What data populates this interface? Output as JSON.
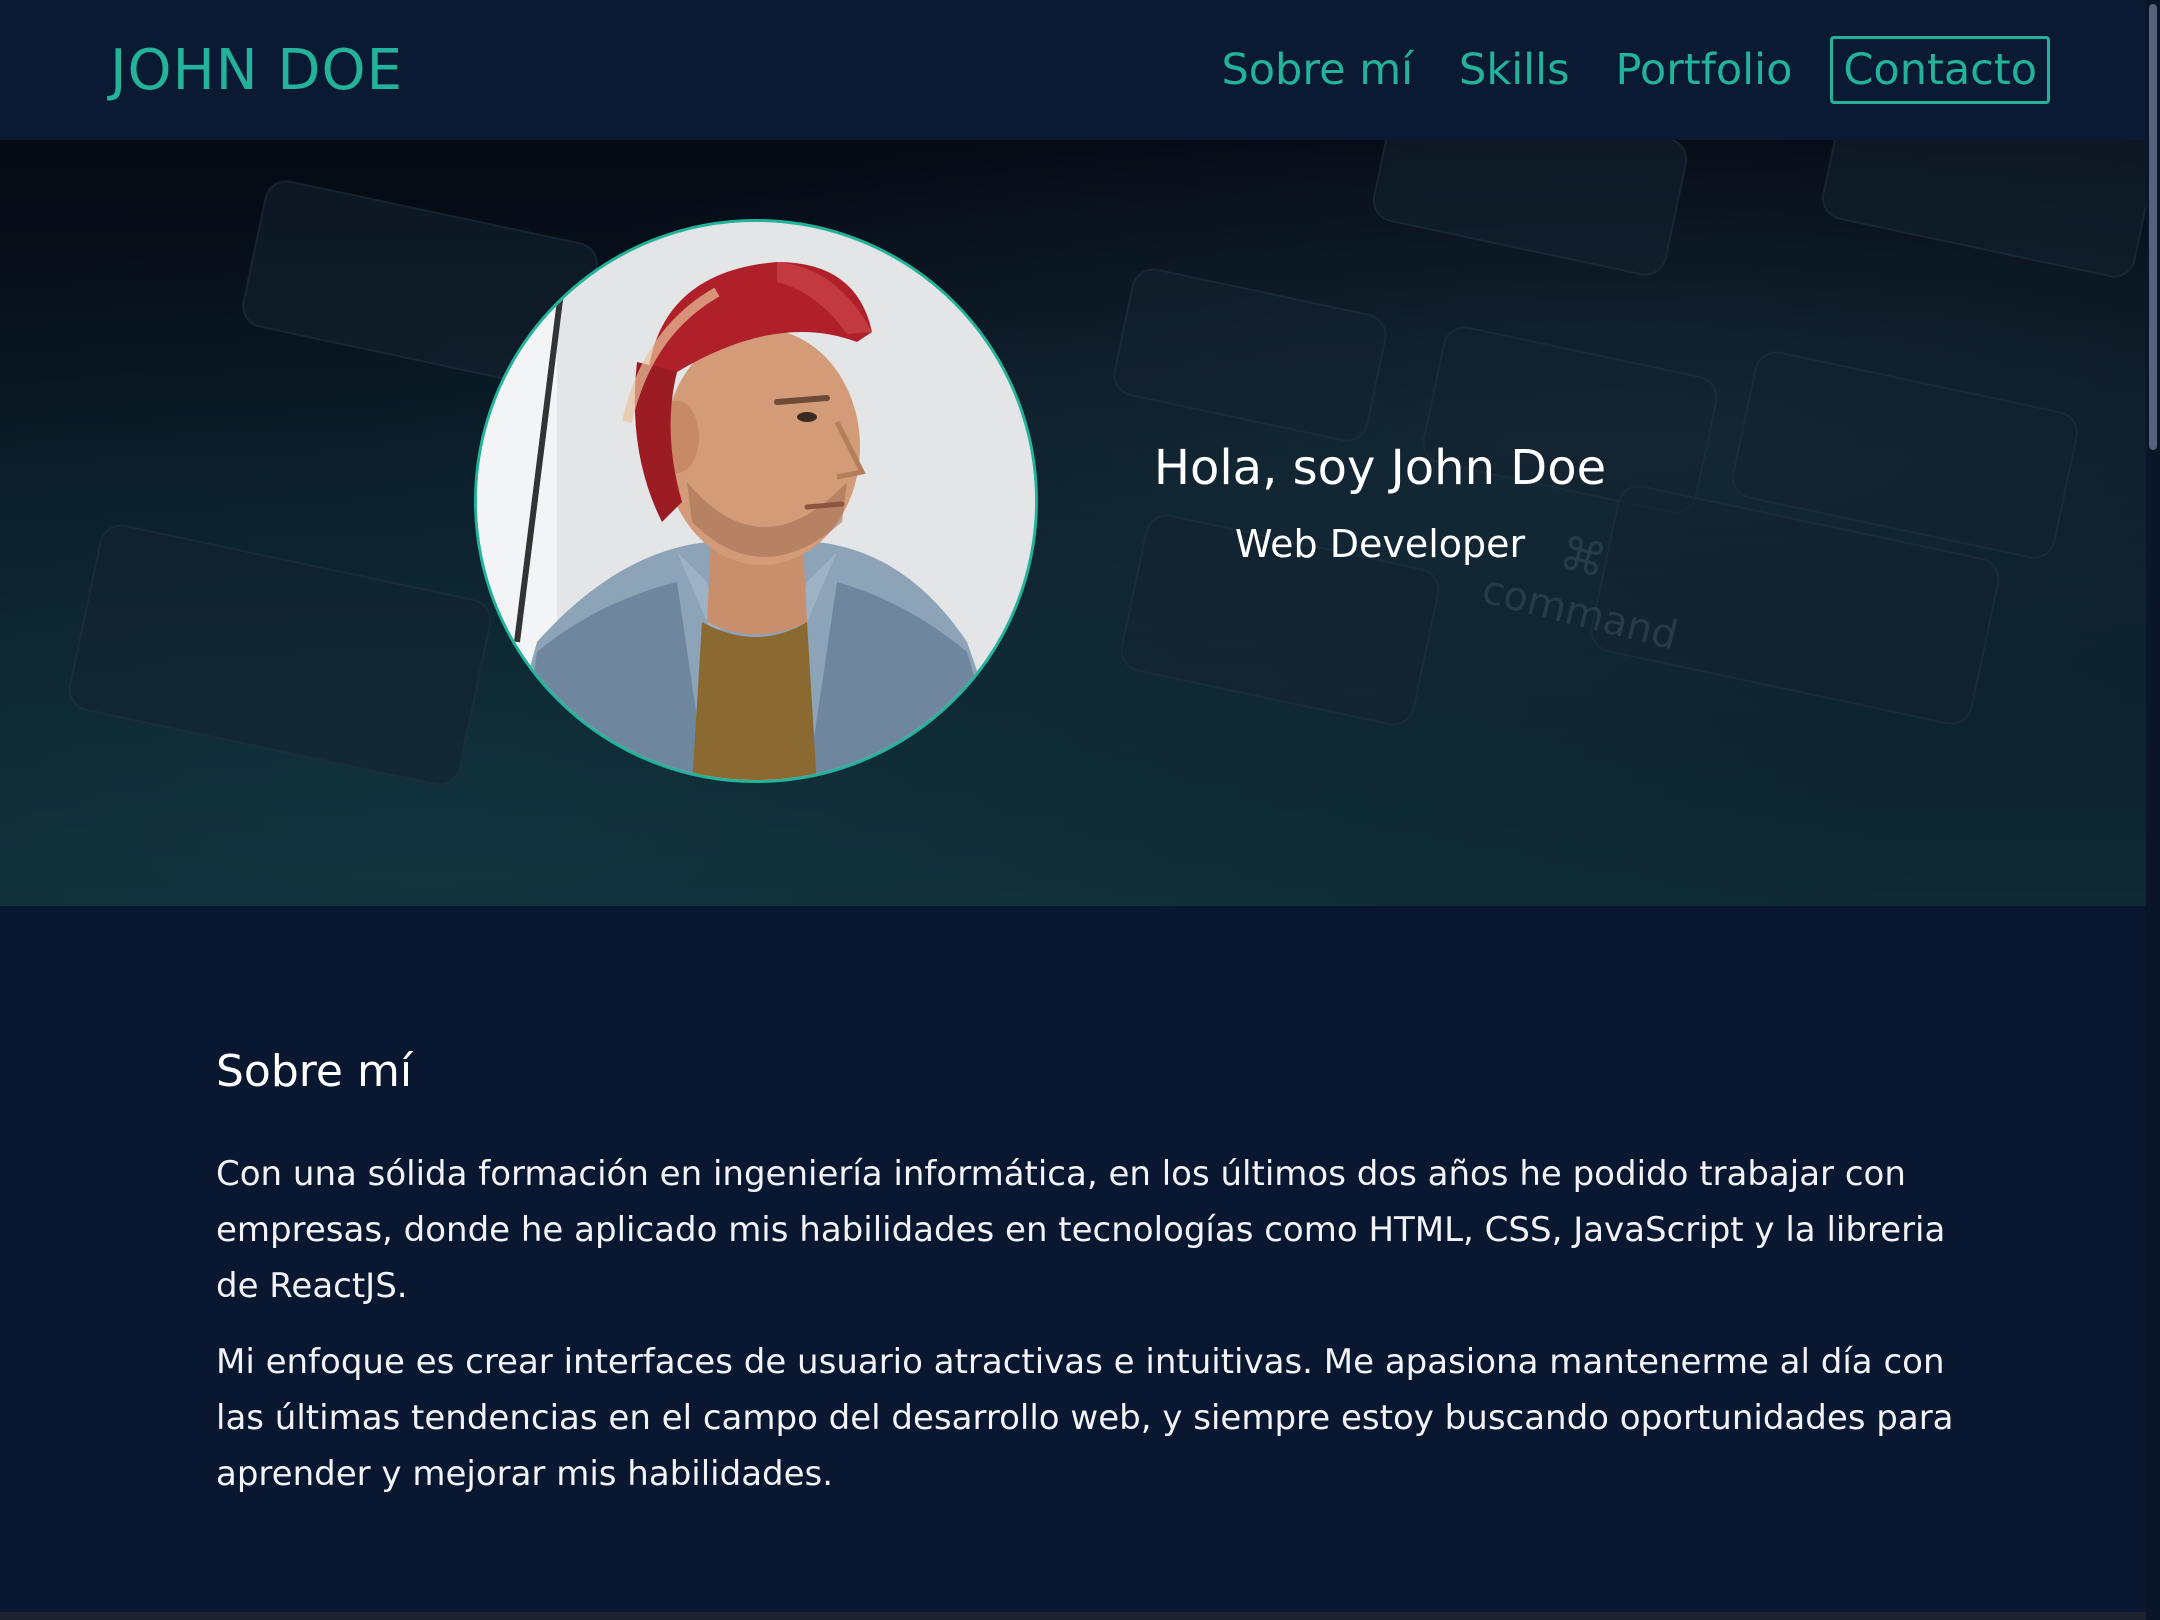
{
  "header": {
    "brand": "JOHN DOE",
    "nav": [
      {
        "label": "Sobre mí"
      },
      {
        "label": "Skills"
      },
      {
        "label": "Portfolio"
      },
      {
        "label": "Contacto"
      }
    ]
  },
  "hero": {
    "title": "Hola, soy John Doe",
    "subtitle": "Web Developer",
    "background_text": "command"
  },
  "about": {
    "heading": "Sobre mí",
    "paragraphs": [
      "Con una sólida formación en ingeniería informática, en los últimos dos años he podido trabajar con empresas, donde he aplicado mis habilidades en tecnologías como HTML, CSS, JavaScript y la libreria de ReactJS.",
      "Mi enfoque es crear interfaces de usuario atractivas e intuitivas. Me apasiona mantenerme al día con las últimas tendencias en el campo del desarrollo web, y siempre estoy buscando oportunidades para aprender y mejorar mis habilidades."
    ]
  },
  "colors": {
    "accent": "#22b39a",
    "header_bg": "#0b1a33",
    "page_bg": "#0a1730",
    "text": "#ffffff"
  }
}
